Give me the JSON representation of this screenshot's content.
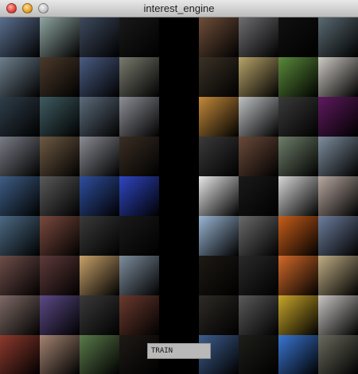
{
  "window": {
    "title": "interest_engine"
  },
  "train_button": {
    "label": "TRAIN"
  },
  "left_grid": {
    "tiles": [
      [
        "#5a6f8e",
        "#8fa5a0",
        "#3e4a5e",
        "#1a1a1a"
      ],
      [
        "#6d7f8c",
        "#4b3a2c",
        "#4a5c82",
        "#7a7b6e"
      ],
      [
        "#2f3e4a",
        "#3f5c62",
        "#5c6b7a",
        "#8e8f96"
      ],
      [
        "#7a7c86",
        "#6e5a44",
        "#8a8c94",
        "#3a2e24"
      ],
      [
        "#3e5e86",
        "#5a5a5a",
        "#2e4e9e",
        "#2f46c2"
      ],
      [
        "#4c6a84",
        "#7a4a3e",
        "#3a3a3a",
        "#1a1a1a"
      ],
      [
        "#6e4e4a",
        "#5e3a3a",
        "#c8a26a",
        "#7e8e9e"
      ],
      [
        "#7e6a66",
        "#5c4a86",
        "#3a3a3a",
        "#6a3a2e"
      ],
      [
        "#8e3a2e",
        "#a48472",
        "#5a7a4a",
        "#1e1a16"
      ]
    ]
  },
  "right_grid": {
    "tiles": [
      [
        "#6e4e3a",
        "#6e6e72",
        "#111111",
        "#5a6a72"
      ],
      [
        "#3a3226",
        "#b8a46a",
        "#5a8a3a",
        "#cfcac4"
      ],
      [
        "#c48a3a",
        "#bfc2c4",
        "#3a3a3a",
        "#5e1a5e"
      ],
      [
        "#3a3a3a",
        "#6a4a3a",
        "#6e7e6a",
        "#7e8e9e"
      ],
      [
        "#e8e8e8",
        "#1a1a1a",
        "#d8d8d8",
        "#b8a8a0"
      ],
      [
        "#9ab6d4",
        "#6a6a6a",
        "#c85e1a",
        "#6e7e9e"
      ],
      [
        "#1e1a14",
        "#2a2a2a",
        "#d26a2a",
        "#bfae86"
      ],
      [
        "#2e2a26",
        "#5a5a5a",
        "#c8a62a",
        "#c8c6c4"
      ],
      [
        "#3e5e8e",
        "#1e1e1a",
        "#3a76d2",
        "#6a6a5e"
      ]
    ]
  }
}
